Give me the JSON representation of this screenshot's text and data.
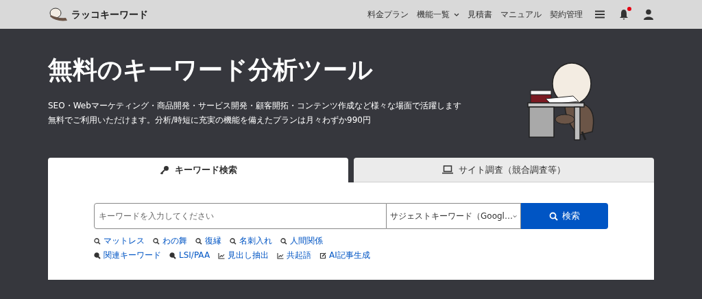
{
  "header": {
    "logo_text": "ラッコキーワード",
    "nav": [
      {
        "label": "料金プラン",
        "dropdown": false
      },
      {
        "label": "機能一覧",
        "dropdown": true
      },
      {
        "label": "見積書",
        "dropdown": false
      },
      {
        "label": "マニュアル",
        "dropdown": false
      },
      {
        "label": "契約管理",
        "dropdown": false
      }
    ],
    "notification_badge": true
  },
  "hero": {
    "title": "無料のキーワード分析ツール",
    "lines": [
      "SEO・Webマーケティング・商品開発・サービス開発・顧客開拓・コンテンツ作成など様々な場面で活躍します",
      "無料でご利用いただけます。分析/時短に充実の機能を備えたプランは月々わずか990円"
    ]
  },
  "tabs": [
    {
      "label": "キーワード検索",
      "kind": "key",
      "selected": true
    },
    {
      "label": "サイト調査（競合調査等）",
      "kind": "laptop",
      "selected": false
    }
  ],
  "search": {
    "placeholder": "キーワードを入力してください",
    "select_value": "サジェストキーワード（Googl…",
    "button": "検索"
  },
  "link_rows": [
    [
      {
        "label": "マットレス",
        "kind": "search"
      },
      {
        "label": "わの舞",
        "kind": "search"
      },
      {
        "label": "復縁",
        "kind": "search"
      },
      {
        "label": "名刺入れ",
        "kind": "search"
      },
      {
        "label": "人間関係",
        "kind": "search"
      }
    ],
    [
      {
        "label": "関連キーワード",
        "kind": "search-bold"
      },
      {
        "label": "LSI/PAA",
        "kind": "search-bold"
      },
      {
        "label": "見出し抽出",
        "kind": "chart"
      },
      {
        "label": "共起語",
        "kind": "chart"
      },
      {
        "label": "AI記事生成",
        "kind": "edit"
      }
    ]
  ]
}
